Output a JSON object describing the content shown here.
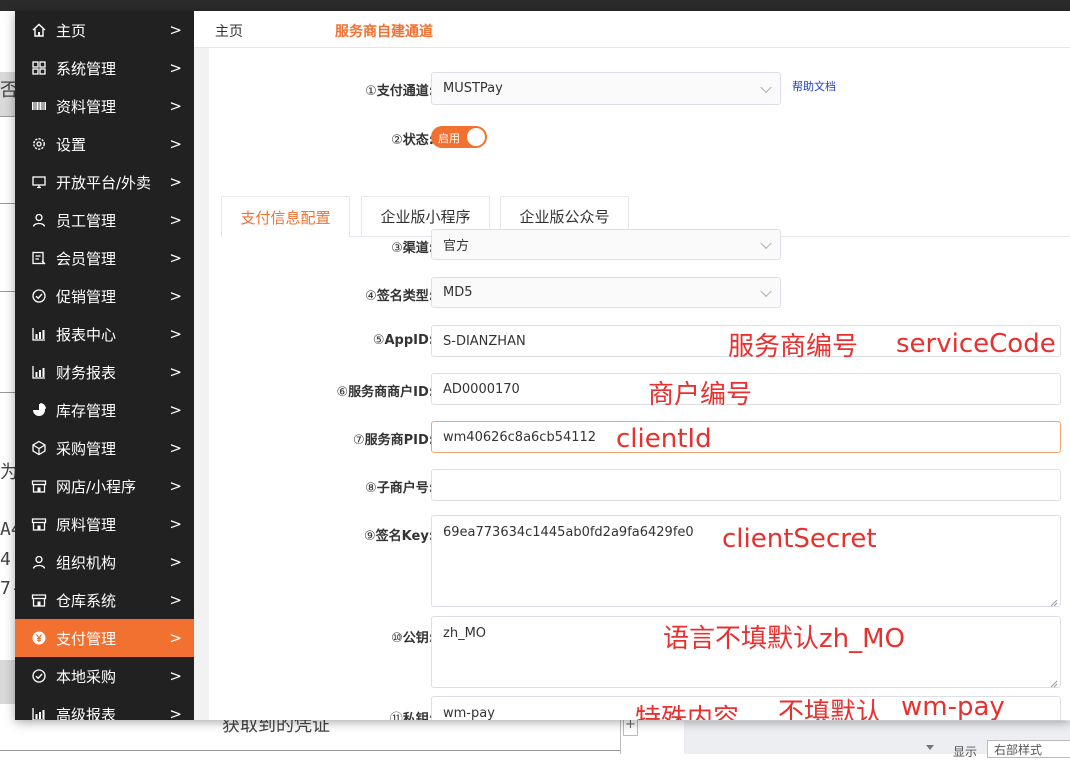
{
  "background_doc": {
    "fragments": [
      "否",
      "为",
      "A4",
      "4",
      "7-",
      "获取到的凭证"
    ],
    "bottom_label": "显示",
    "bottom_select": "右部样式"
  },
  "sidebar": {
    "items": [
      {
        "label": "主页",
        "icon": "home-icon",
        "active": false
      },
      {
        "label": "系统管理",
        "icon": "grid-icon",
        "active": false
      },
      {
        "label": "资料管理",
        "icon": "barcode-icon",
        "active": false
      },
      {
        "label": "设置",
        "icon": "gear-icon",
        "active": false
      },
      {
        "label": "开放平台/外卖",
        "icon": "monitor-icon",
        "active": false
      },
      {
        "label": "员工管理",
        "icon": "user-icon",
        "active": false
      },
      {
        "label": "会员管理",
        "icon": "member-card-icon",
        "active": false
      },
      {
        "label": "促销管理",
        "icon": "check-circle-icon",
        "active": false
      },
      {
        "label": "报表中心",
        "icon": "bar-chart-icon",
        "active": false
      },
      {
        "label": "财务报表",
        "icon": "bar-chart-icon",
        "active": false
      },
      {
        "label": "库存管理",
        "icon": "pie-chart-icon",
        "active": false
      },
      {
        "label": "采购管理",
        "icon": "cube-icon",
        "active": false
      },
      {
        "label": "网店/小程序",
        "icon": "store-icon",
        "active": false
      },
      {
        "label": "原料管理",
        "icon": "store-icon",
        "active": false
      },
      {
        "label": "组织机构",
        "icon": "user-icon",
        "active": false
      },
      {
        "label": "仓库系统",
        "icon": "store-icon",
        "active": false
      },
      {
        "label": "支付管理",
        "icon": "yen-coin-icon",
        "active": true
      },
      {
        "label": "本地采购",
        "icon": "check-circle-icon",
        "active": false
      },
      {
        "label": "高级报表",
        "icon": "bar-chart-icon",
        "active": false
      }
    ],
    "arrow": ">"
  },
  "topnav": {
    "home_tab": "主页",
    "current_tab": "服务商自建通道"
  },
  "form": {
    "channel": {
      "num": "①",
      "label": "支付通道:",
      "value": "MUSTPay"
    },
    "help_link": "帮助文档",
    "status": {
      "num": "②",
      "label": "状态:",
      "toggle_text": "启用",
      "on": true
    },
    "tabs": [
      "支付信息配置",
      "企业版小程序",
      "企业版公众号"
    ],
    "fields": [
      {
        "num": "③",
        "label": "渠道:",
        "value": "官方",
        "type": "select"
      },
      {
        "num": "④",
        "label": "签名类型:",
        "value": "MD5",
        "type": "select"
      },
      {
        "num": "⑤",
        "label": "AppID:",
        "value": "S-DIANZHAN",
        "type": "text"
      },
      {
        "num": "⑥",
        "label": "服务商商户ID:",
        "value": "AD0000170",
        "type": "text"
      },
      {
        "num": "⑦",
        "label": "服务商PID:",
        "value": "wm40626c8a6cb54112",
        "type": "text"
      },
      {
        "num": "⑧",
        "label": "子商户号:",
        "value": "",
        "type": "text"
      },
      {
        "num": "⑨",
        "label": "签名Key:",
        "value": "69ea773634c1445ab0fd2a9fa6429fe0",
        "type": "textarea"
      },
      {
        "num": "⑩",
        "label": "公钥:",
        "value": "zh_MO",
        "type": "textarea"
      },
      {
        "num": "⑪",
        "label": "私钥:",
        "value": "wm-pay",
        "type": "textarea"
      }
    ]
  },
  "annotations": {
    "service_no": "服务商编号",
    "service_code": "serviceCode",
    "merchant_no": "商户编号",
    "client_id": "clientId",
    "client_secret": "clientSecret",
    "language_note": "语言不填默认zh_MO",
    "special": "特殊内容",
    "default_note": "不填默认",
    "default_value": "wm-pay"
  },
  "colors": {
    "accent": "#f27131",
    "sidebar_bg": "#212121",
    "annotation_red": "#e8312f",
    "link_blue": "#1d3fbf"
  }
}
